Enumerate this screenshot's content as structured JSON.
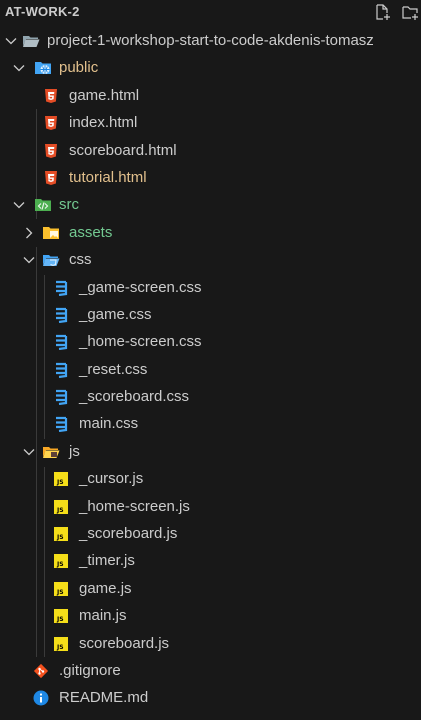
{
  "header": {
    "title": "AT-WORK-2"
  },
  "tree": {
    "root": "project-1-workshop-start-to-code-akdenis-tomasz",
    "public": {
      "label": "public",
      "files": [
        "game.html",
        "index.html",
        "scoreboard.html",
        "tutorial.html"
      ]
    },
    "src": {
      "label": "src",
      "assets": "assets",
      "css": {
        "label": "css",
        "files": [
          "_game-screen.css",
          "_game.css",
          "_home-screen.css",
          "_reset.css",
          "_scoreboard.css",
          "main.css"
        ]
      },
      "js": {
        "label": "js",
        "files": [
          "_cursor.js",
          "_home-screen.js",
          "_scoreboard.js",
          "_timer.js",
          "game.js",
          "main.js",
          "scoreboard.js"
        ]
      }
    },
    "gitignore": ".gitignore",
    "readme": "README.md"
  },
  "colors": {
    "background": "#181818",
    "text": "#cccccc",
    "modified": "#e2c08d",
    "untracked": "#73c991",
    "html_icon": "#e44d26",
    "css_icon": "#42a5f5",
    "js_icon": "#f5de19",
    "git_icon": "#f4511e",
    "info_icon": "#1e88e5"
  },
  "icons": {
    "new_file": "new-file-icon",
    "new_folder": "new-folder-icon",
    "chevron": "chevron-down-icon",
    "folder": "folder-icon",
    "html": "html5-icon",
    "css": "css3-icon",
    "js": "js-icon",
    "git": "git-icon",
    "info": "info-icon"
  }
}
